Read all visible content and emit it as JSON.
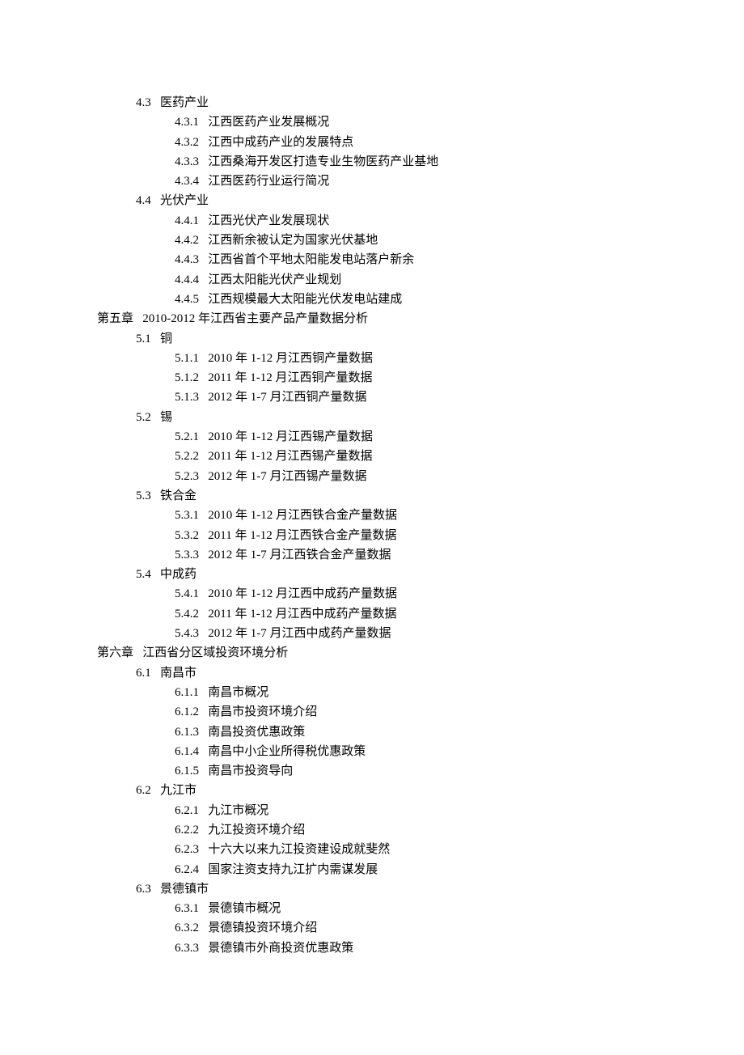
{
  "entries": [
    {
      "level": "section",
      "num": "4.3",
      "title": "医药产业"
    },
    {
      "level": "subsection",
      "num": "4.3.1",
      "title": "江西医药产业发展概况"
    },
    {
      "level": "subsection",
      "num": "4.3.2",
      "title": "江西中成药产业的发展特点"
    },
    {
      "level": "subsection",
      "num": "4.3.3",
      "title": "江西桑海开发区打造专业生物医药产业基地"
    },
    {
      "level": "subsection",
      "num": "4.3.4",
      "title": "江西医药行业运行简况"
    },
    {
      "level": "section",
      "num": "4.4",
      "title": "光伏产业"
    },
    {
      "level": "subsection",
      "num": "4.4.1",
      "title": "江西光伏产业发展现状"
    },
    {
      "level": "subsection",
      "num": "4.4.2",
      "title": "江西新余被认定为国家光伏基地"
    },
    {
      "level": "subsection",
      "num": "4.4.3",
      "title": "江西省首个平地太阳能发电站落户新余"
    },
    {
      "level": "subsection",
      "num": "4.4.4",
      "title": "江西太阳能光伏产业规划"
    },
    {
      "level": "subsection",
      "num": "4.4.5",
      "title": "江西规模最大太阳能光伏发电站建成"
    },
    {
      "level": "chapter",
      "num": "第五章",
      "title": "2010-2012 年江西省主要产品产量数据分析"
    },
    {
      "level": "section",
      "num": "5.1",
      "title": "铜"
    },
    {
      "level": "subsection",
      "num": "5.1.1",
      "title": "2010 年 1-12 月江西铜产量数据"
    },
    {
      "level": "subsection",
      "num": "5.1.2",
      "title": "2011 年 1-12 月江西铜产量数据"
    },
    {
      "level": "subsection",
      "num": "5.1.3",
      "title": "2012 年 1-7 月江西铜产量数据"
    },
    {
      "level": "section",
      "num": "5.2",
      "title": "锡"
    },
    {
      "level": "subsection",
      "num": "5.2.1",
      "title": "2010 年 1-12 月江西锡产量数据"
    },
    {
      "level": "subsection",
      "num": "5.2.2",
      "title": "2011 年 1-12 月江西锡产量数据"
    },
    {
      "level": "subsection",
      "num": "5.2.3",
      "title": "2012 年 1-7 月江西锡产量数据"
    },
    {
      "level": "section",
      "num": "5.3",
      "title": "铁合金"
    },
    {
      "level": "subsection",
      "num": "5.3.1",
      "title": "2010 年 1-12 月江西铁合金产量数据"
    },
    {
      "level": "subsection",
      "num": "5.3.2",
      "title": "2011 年 1-12 月江西铁合金产量数据"
    },
    {
      "level": "subsection",
      "num": "5.3.3",
      "title": "2012 年 1-7 月江西铁合金产量数据"
    },
    {
      "level": "section",
      "num": "5.4",
      "title": "中成药"
    },
    {
      "level": "subsection",
      "num": "5.4.1",
      "title": "2010 年 1-12 月江西中成药产量数据"
    },
    {
      "level": "subsection",
      "num": "5.4.2",
      "title": "2011 年 1-12 月江西中成药产量数据"
    },
    {
      "level": "subsection",
      "num": "5.4.3",
      "title": "2012 年 1-7 月江西中成药产量数据"
    },
    {
      "level": "chapter",
      "num": "第六章",
      "title": "江西省分区域投资环境分析"
    },
    {
      "level": "section",
      "num": "6.1",
      "title": "南昌市"
    },
    {
      "level": "subsection",
      "num": "6.1.1",
      "title": "南昌市概况"
    },
    {
      "level": "subsection",
      "num": "6.1.2",
      "title": "南昌市投资环境介绍"
    },
    {
      "level": "subsection",
      "num": "6.1.3",
      "title": "南昌投资优惠政策"
    },
    {
      "level": "subsection",
      "num": "6.1.4",
      "title": "南昌中小企业所得税优惠政策"
    },
    {
      "level": "subsection",
      "num": "6.1.5",
      "title": "南昌市投资导向"
    },
    {
      "level": "section",
      "num": "6.2",
      "title": "九江市"
    },
    {
      "level": "subsection",
      "num": "6.2.1",
      "title": "九江市概况"
    },
    {
      "level": "subsection",
      "num": "6.2.2",
      "title": "九江投资环境介绍"
    },
    {
      "level": "subsection",
      "num": "6.2.3",
      "title": "十六大以来九江投资建设成就斐然"
    },
    {
      "level": "subsection",
      "num": "6.2.4",
      "title": "国家注资支持九江扩内需谋发展"
    },
    {
      "level": "section",
      "num": "6.3",
      "title": "景德镇市"
    },
    {
      "level": "subsection",
      "num": "6.3.1",
      "title": "景德镇市概况"
    },
    {
      "level": "subsection",
      "num": "6.3.2",
      "title": "景德镇投资环境介绍"
    },
    {
      "level": "subsection",
      "num": "6.3.3",
      "title": "景德镇市外商投资优惠政策"
    }
  ]
}
